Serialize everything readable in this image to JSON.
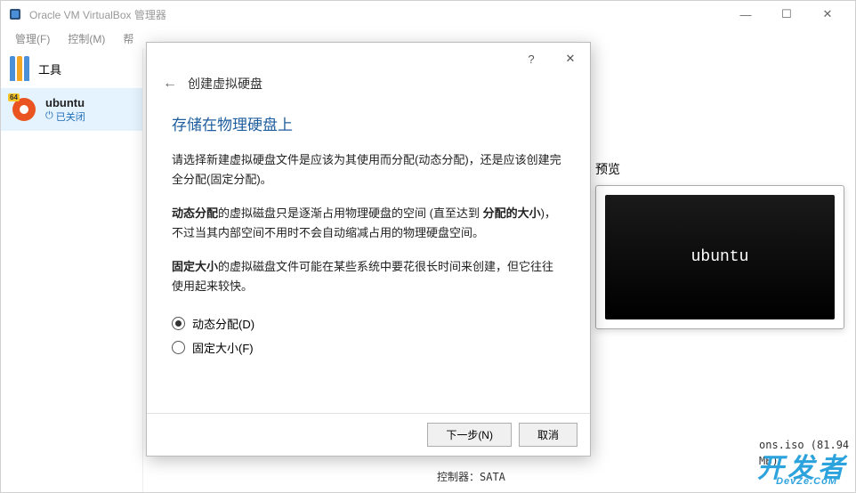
{
  "window": {
    "title": "Oracle VM VirtualBox 管理器",
    "controls": {
      "minimize": "—",
      "maximize": "☐",
      "close": "✕"
    }
  },
  "menu": {
    "file": "管理(F)",
    "control": "控制(M)",
    "help": "帮"
  },
  "sidebar": {
    "tools_label": "工具",
    "vm": {
      "badge": "64",
      "name": "ubuntu",
      "state_icon": "⏻",
      "state": "已关闭"
    }
  },
  "right_pane": {
    "header": "预览",
    "preview_text": "ubuntu"
  },
  "bottom": {
    "line1": "ons.iso (81.94 MB)",
    "line2": "控制器：SATA"
  },
  "watermark": {
    "main": "开发者",
    "sub": "DevZe.CoM"
  },
  "dialog": {
    "help": "?",
    "close": "✕",
    "back": "←",
    "title": "创建虚拟硬盘",
    "section": "存储在物理硬盘上",
    "para1": "请选择新建虚拟硬盘文件是应该为其使用而分配(动态分配)，还是应该创建完全分配(固定分配)。",
    "para2_bold1": "动态分配",
    "para2_rest": "的虚拟磁盘只是逐渐占用物理硬盘的空间 (直至达到 ",
    "para2_bold2": "分配的大小",
    "para2_end": ")，不过当其内部空间不用时不会自动缩减占用的物理硬盘空间。",
    "para3_bold": "固定大小",
    "para3_rest": "的虚拟磁盘文件可能在某些系统中要花很长时间来创建，但它往往使用起来较快。",
    "radio1": "动态分配(D)",
    "radio2": "固定大小(F)",
    "next": "下一步(N)",
    "cancel": "取消"
  }
}
